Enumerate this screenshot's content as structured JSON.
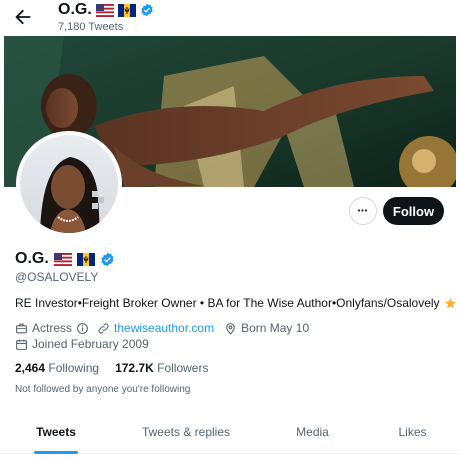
{
  "header": {
    "name": "O.G.",
    "tweet_count": "7,180 Tweets"
  },
  "profile": {
    "name": "O.G.",
    "handle": "@OSALOVELY",
    "bio": "RE Investor•Freight Broker Owner • BA for The Wise Author•Onlyfans/Osalovely",
    "category": "Actress",
    "website": "thewiseauthor.com",
    "birth": "Born May 10",
    "joined": "Joined February 2009",
    "following_count": "2,464",
    "following_label": "Following",
    "followers_count": "172.7K",
    "followers_label": "Followers",
    "not_followed": "Not followed by anyone you're following"
  },
  "actions": {
    "more": "•••",
    "follow": "Follow"
  },
  "tabs": [
    {
      "label": "Tweets",
      "active": true
    },
    {
      "label": "Tweets & replies",
      "active": false
    },
    {
      "label": "Media",
      "active": false
    },
    {
      "label": "Likes",
      "active": false
    }
  ],
  "colors": {
    "accent": "#1d9bf0",
    "text": "#0f1419",
    "muted": "#536471",
    "banner_green": "#1e3a2a",
    "banner_gold": "#c9a35a"
  },
  "icons": [
    "back-arrow-icon",
    "flag-us-icon",
    "flag-barbados-icon",
    "verified-badge-icon",
    "star-emoji-icon",
    "briefcase-icon",
    "info-icon",
    "link-icon",
    "location-pin-icon",
    "calendar-icon"
  ]
}
